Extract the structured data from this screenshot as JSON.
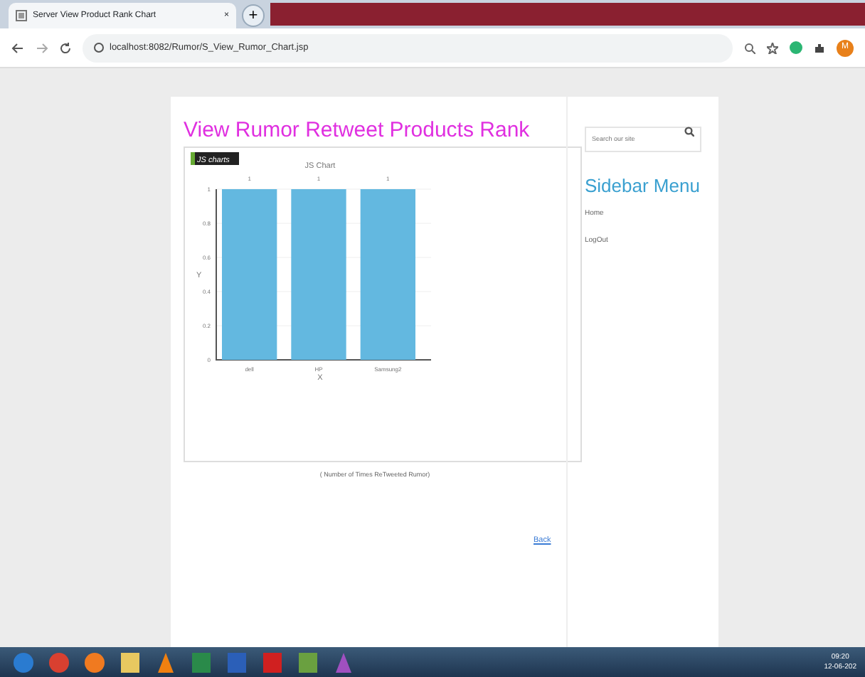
{
  "browser": {
    "tab_title": "Server View Product Rank Chart",
    "tab_close": "×",
    "new_tab": "+",
    "url": "localhost:8082/Rumor/S_View_Rumor_Chart.jsp",
    "avatar": "M"
  },
  "page": {
    "heading": "View Rumor Retweet Products Rank",
    "logo": "JS charts",
    "chart_data": {
      "type": "bar",
      "title": "JS Chart",
      "xlabel": "X",
      "ylabel": "Y",
      "categories": [
        "dell",
        "HP",
        "Samsung2"
      ],
      "series": [
        {
          "color": "#63b8e0",
          "values": [
            1,
            1,
            1
          ]
        }
      ],
      "ylim": [
        0,
        1
      ],
      "grid": true,
      "yticks": [
        0,
        0.2,
        0.4,
        0.6,
        0.8,
        1
      ],
      "data_labels": true
    },
    "caption": "( Number of Times ReTweeted Rumor)",
    "back_link": "Back"
  },
  "sidebar": {
    "search_placeholder": "Search our site",
    "title": "Sidebar Menu",
    "items": [
      "Home",
      "LogOut"
    ]
  },
  "taskbar": {
    "time": "09:20",
    "date": "12-06-202"
  }
}
